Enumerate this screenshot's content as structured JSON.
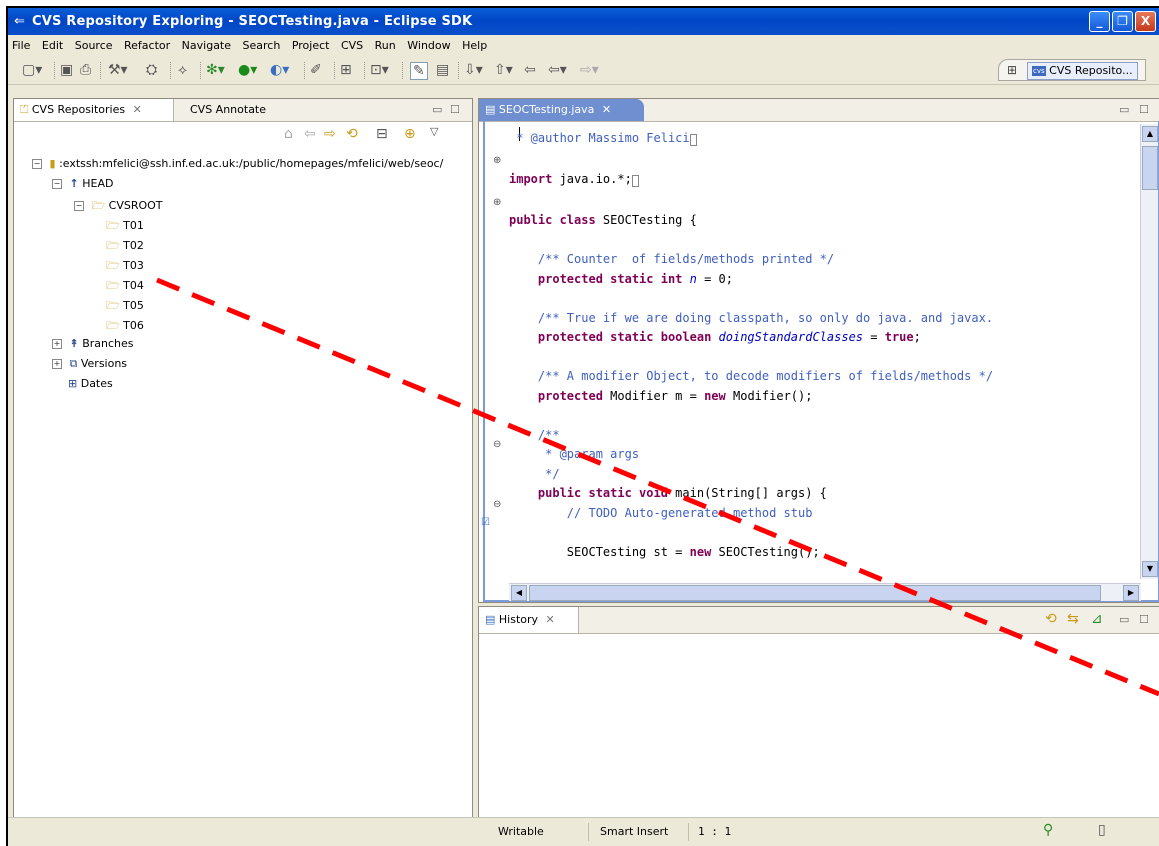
{
  "window": {
    "title": "CVS Repository Exploring - SEOCTesting.java - Eclipse SDK",
    "buttons": [
      "_",
      "❐",
      "X"
    ]
  },
  "menu": [
    "File",
    "Edit",
    "Source",
    "Refactor",
    "Navigate",
    "Search",
    "Project",
    "CVS",
    "Run",
    "Window",
    "Help"
  ],
  "perspective": {
    "label": "CVS Reposito...",
    "badge": "cvs"
  },
  "left_panel": {
    "tabs": [
      {
        "label": "CVS Repositories"
      },
      {
        "label": "CVS Annotate"
      }
    ],
    "tree": {
      "root": ":extssh:mfelici@ssh.inf.ed.ac.uk:/public/homepages/mfelici/web/seoc/",
      "head": "HEAD",
      "cvsroot": "CVSROOT",
      "folders": [
        "T01",
        "T02",
        "T03",
        "T04",
        "T05",
        "T06"
      ],
      "branches": "Branches",
      "versions": "Versions",
      "dates": "Dates"
    }
  },
  "editor": {
    "tab_label": "SEOCTesting.java",
    "lines": {
      "l1_comment": " * @author Massimo Felici",
      "l2_kw": "import",
      "l2_rest": " java.io.*;",
      "l3_kw": "public class",
      "l3_rest": " SEOCTesting {",
      "l4_cm": "    /** Counter  of fields/methods printed */",
      "l5_kw": "    protected static int",
      "l5_it": "n",
      "l5_rest": " = 0;",
      "l6_cm": "    /** True if we are doing classpath, so only do java. and javax.",
      "l7_kw": "    protected static boolean",
      "l7_it": "doingStandardClasses",
      "l7_rest": " = ",
      "l7_kw2": "true",
      "l7_end": ";",
      "l8_cm": "    /** A modifier Object, to decode modifiers of fields/methods */",
      "l9_kw": "    protected",
      "l9_rest": " Modifier m = ",
      "l9_kw2": "new",
      "l9_end": " Modifier();",
      "l10_cm": "    /**",
      "l11_cm": "     * @param args",
      "l12_cm": "     */",
      "l13_kw": "    public static void",
      "l13_rest": " main(String[] args) {",
      "l14_cm": "        // TODO Auto-generated method stub",
      "l15_pre": "        SEOCTesting st = ",
      "l15_kw": "new",
      "l15_rest": " SEOCTesting();"
    }
  },
  "history_panel": {
    "tab_label": "History"
  },
  "status": {
    "writable": "Writable",
    "insert_mode": "Smart Insert",
    "position": "1 : 1"
  },
  "colors": {
    "annotation_line": "#ff0000",
    "title_bar": "#0a5fd8",
    "selection": "#6f8fd0"
  }
}
